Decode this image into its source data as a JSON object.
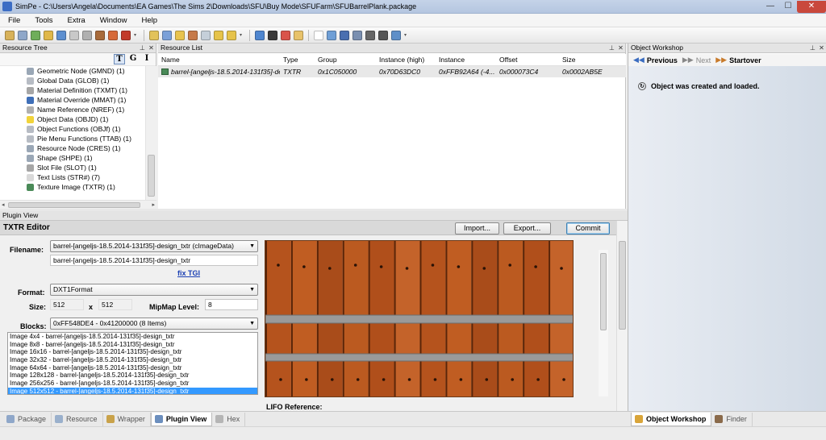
{
  "window": {
    "title": "SimPe - C:\\Users\\Angela\\Documents\\EA Games\\The Sims 2\\Downloads\\SFU\\Buy Mode\\SFUFarm\\SFUBarrelPlank.package",
    "minimize": "—",
    "maximize": "☐",
    "close": "✕"
  },
  "menu": [
    "File",
    "Tools",
    "Extra",
    "Window",
    "Help"
  ],
  "panels": {
    "tree_title": "Resource Tree",
    "list_title": "Resource List",
    "plugin_title": "Plugin View",
    "workshop_title": "Object Workshop",
    "pin": "⊥",
    "close": "✕"
  },
  "tree": {
    "tools": [
      "T",
      "G",
      "I"
    ],
    "items": [
      {
        "label": "Geometric Node (GMND) (1)",
        "icon_color": "#9aa7b6"
      },
      {
        "label": "Global Data (GLOB) (1)",
        "icon_color": "#b7bcc4"
      },
      {
        "label": "Material Definition (TXMT) (1)",
        "icon_color": "#a6a6a6"
      },
      {
        "label": "Material Override (MMAT) (1)",
        "icon_color": "#3f6fb8"
      },
      {
        "label": "Name Reference (NREF) (1)",
        "icon_color": "#b0b0b0"
      },
      {
        "label": "Object Data (OBJD) (1)",
        "icon_color": "#f2d43a"
      },
      {
        "label": "Object Functions (OBJf) (1)",
        "icon_color": "#b7bcc4"
      },
      {
        "label": "Pie Menu Functions (TTAB) (1)",
        "icon_color": "#b7bcc4"
      },
      {
        "label": "Resource Node (CRES) (1)",
        "icon_color": "#9aa7b6"
      },
      {
        "label": "Shape (SHPE) (1)",
        "icon_color": "#9aa7b6"
      },
      {
        "label": "Slot File (SLOT) (1)",
        "icon_color": "#a6a6a6"
      },
      {
        "label": "Text Lists (STR#) (7)",
        "icon_color": "#d9d9d9"
      },
      {
        "label": "Texture Image (TXTR) (1)",
        "icon_color": "#4a8a58"
      }
    ],
    "scroll_left": "◂",
    "scroll_right": "▸"
  },
  "resource_list": {
    "columns": [
      "Name",
      "Type",
      "Group",
      "Instance (high)",
      "Instance",
      "Offset",
      "Size"
    ],
    "rows": [
      [
        "barrel-[angeljs-18.5.2014-131f35]-de...",
        "TXTR",
        "0x1C050000",
        "0x70D63DC0",
        "0xFFB92A64 (-4...",
        "0x000073C4",
        "0x0002AB5E"
      ]
    ]
  },
  "editor": {
    "title": "TXTR Editor",
    "import_label": "Import...",
    "export_label": "Export...",
    "commit_label": "Commit",
    "filename_label": "Filename:",
    "filename_combo": "barrel-[angeljs-18.5.2014-131f35]-design_txtr (cImageData)",
    "filename_value": "barrel-[angeljs-18.5.2014-131f35]-design_txtr",
    "fix_tgi": "fix TGI",
    "format_label": "Format:",
    "format_value": "DXT1Format",
    "size_label": "Size:",
    "width": "512",
    "times": "x",
    "height": "512",
    "mipmap_label": "MipMap Level:",
    "mipmap_value": "8",
    "blocks_label": "Blocks:",
    "blocks_value": "0xFF548DE4 - 0x41200000 (8 Items)",
    "images": [
      "Image 4x4 - barrel-[angeljs-18.5.2014-131f35]-design_txtr",
      "Image 8x8 - barrel-[angeljs-18.5.2014-131f35]-design_txtr",
      "Image 16x16 - barrel-[angeljs-18.5.2014-131f35]-design_txtr",
      "Image 32x32 - barrel-[angeljs-18.5.2014-131f35]-design_txtr",
      "Image 64x64 - barrel-[angeljs-18.5.2014-131f35]-design_txtr",
      "Image 128x128 - barrel-[angeljs-18.5.2014-131f35]-design_txtr",
      "Image 256x256 - barrel-[angeljs-18.5.2014-131f35]-design_txtr",
      "Image 512x512 - barrel-[angeljs-18.5.2014-131f35]-design_txtr"
    ],
    "selected_image_index": 7,
    "lifo_label": "LIFO Reference:",
    "dropdown_arrow": "▼"
  },
  "workshop": {
    "previous": "Previous",
    "next": "Next",
    "startover": "Startover",
    "message": "Object was created and loaded.",
    "msg_icon": "↻"
  },
  "bottom_tabs": [
    {
      "label": "Package",
      "icon_color": "#8fa7c9"
    },
    {
      "label": "Resource",
      "icon_color": "#9ab0cc"
    },
    {
      "label": "Wrapper",
      "icon_color": "#c9a24a"
    },
    {
      "label": "Plugin View",
      "icon_color": "#6c8fbe"
    },
    {
      "label": "Hex",
      "icon_color": "#b5b5b5"
    }
  ],
  "active_bottom_tab": 3,
  "workshop_tabs": [
    {
      "label": "Object Workshop",
      "icon_color": "#d9a53a"
    },
    {
      "label": "Finder",
      "icon_color": "#8a6a4a"
    }
  ],
  "colors": {
    "selection": "#3399ff",
    "wood": "#b9571f",
    "metal_band": "#9a9a9a"
  }
}
